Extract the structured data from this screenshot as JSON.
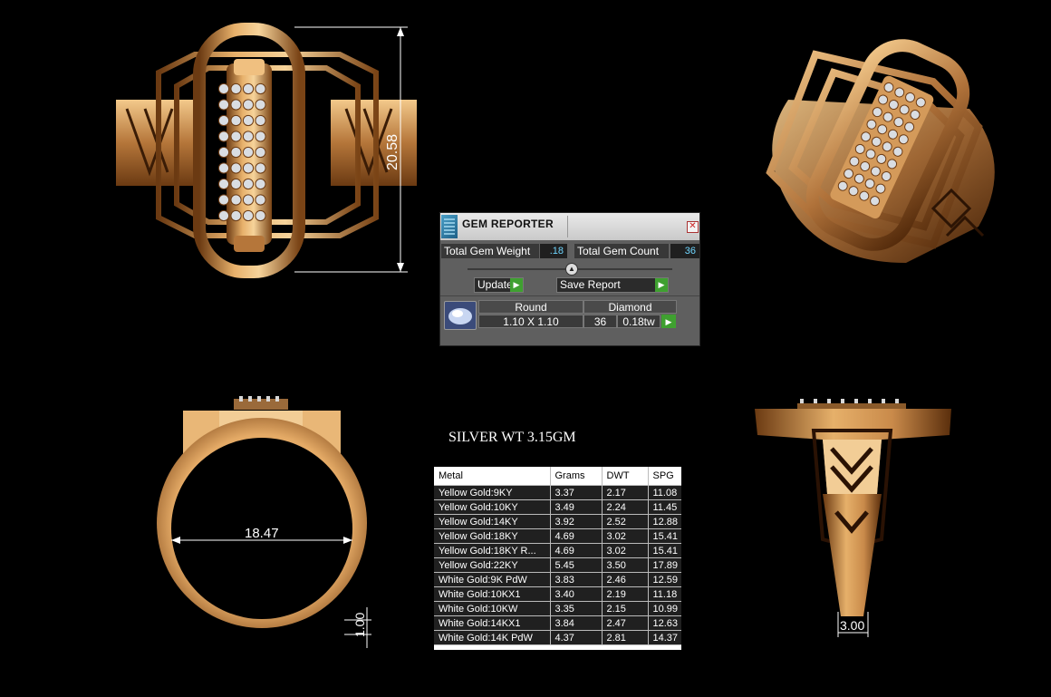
{
  "dimensions": {
    "height": "20.58",
    "inner_diameter": "18.47",
    "shank_thickness": "1.00",
    "shank_width": "3.00"
  },
  "gem_reporter": {
    "title": "GEM REPORTER",
    "close_icon": "close-icon",
    "total_weight_label": "Total Gem Weight",
    "total_weight_value": ".18",
    "total_count_label": "Total Gem Count",
    "total_count_value": "36",
    "update_label": "Update",
    "save_label": "Save Report",
    "row": {
      "shape": "Round",
      "type": "Diamond",
      "size": "1.10 X 1.10",
      "count": "36",
      "weight": "0.18tw"
    }
  },
  "silver_weight": "SILVER WT 3.15GM",
  "metal_table": {
    "headers": [
      "Metal",
      "Grams",
      "DWT",
      "SPG"
    ],
    "rows": [
      [
        "Yellow Gold:9KY",
        "3.37",
        "2.17",
        "11.08"
      ],
      [
        "Yellow Gold:10KY",
        "3.49",
        "2.24",
        "11.45"
      ],
      [
        "Yellow Gold:14KY",
        "3.92",
        "2.52",
        "12.88"
      ],
      [
        "Yellow Gold:18KY",
        "4.69",
        "3.02",
        "15.41"
      ],
      [
        "Yellow Gold:18KY R...",
        "4.69",
        "3.02",
        "15.41"
      ],
      [
        "Yellow Gold:22KY",
        "5.45",
        "3.50",
        "17.89"
      ],
      [
        "White Gold:9K PdW",
        "3.83",
        "2.46",
        "12.59"
      ],
      [
        "White Gold:10KX1",
        "3.40",
        "2.19",
        "11.18"
      ],
      [
        "White Gold:10KW",
        "3.35",
        "2.15",
        "10.99"
      ],
      [
        "White Gold:14KX1",
        "3.84",
        "2.47",
        "12.63"
      ],
      [
        "White Gold:14K PdW",
        "4.37",
        "2.81",
        "14.37"
      ]
    ]
  },
  "colors": {
    "gold_light": "#f0c080",
    "gold_mid": "#c98a4a",
    "gold_dark": "#6b3a12",
    "accent_value": "#6fd6ff",
    "button_green": "#3fa030"
  }
}
